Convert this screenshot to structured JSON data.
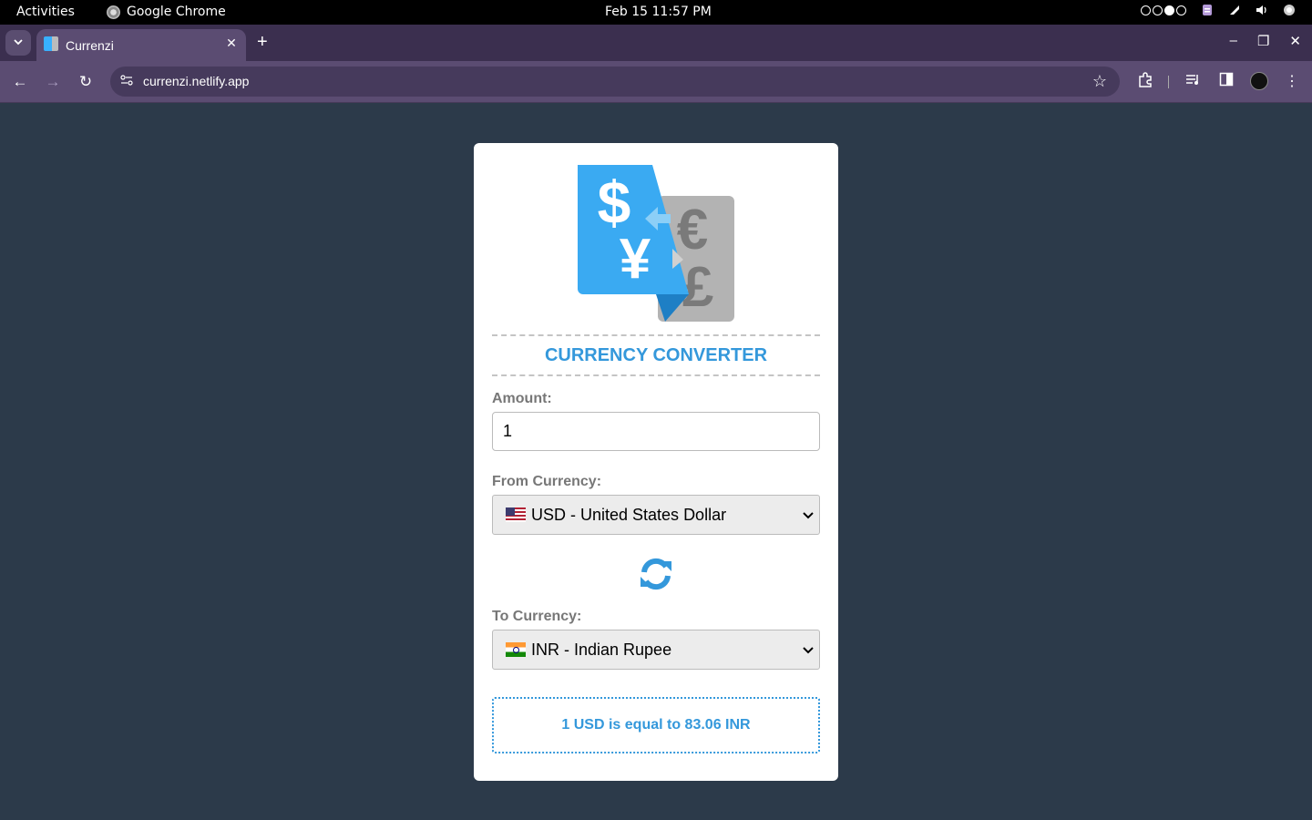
{
  "os": {
    "activities": "Activities",
    "app_name": "Google Chrome",
    "clock": "Feb 15  11:57 PM"
  },
  "browser": {
    "tab_title": "Currenzi",
    "url": "currenzi.netlify.app"
  },
  "converter": {
    "heading": "CURRENCY CONVERTER",
    "amount_label": "Amount:",
    "amount_value": "1",
    "from_label": "From Currency:",
    "from_value": "USD - United States Dollar",
    "from_flag": "us-flag",
    "to_label": "To Currency:",
    "to_value": "INR - Indian Rupee",
    "to_flag": "india-flag",
    "result": "1 USD is equal to 83.06 INR",
    "accent_color": "#3498db",
    "background_color": "#2c3a4a"
  }
}
